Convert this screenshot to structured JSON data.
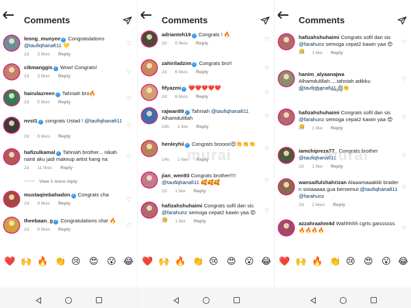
{
  "screen_title": "Comments",
  "reply_label": "Reply",
  "watermark": "murai",
  "panels": [
    {
      "comments": [
        {
          "user": "leong_munyee",
          "verified": true,
          "text": "Congratulations",
          "mention": "@taufiqhanafi11",
          "emoji": "💛",
          "time": "1d",
          "likes": "3 likes",
          "avatar": "#6b8f9a"
        },
        {
          "user": "cikmanggis",
          "verified": true,
          "text": "Wow! Congrats!",
          "time": "1d",
          "likes": "3 likes",
          "avatar": "#c27f6a"
        },
        {
          "user": "hairulazreen",
          "verified": true,
          "text": "Tahniah bro🔥",
          "time": "1d",
          "likes": "5 likes",
          "avatar": "#2f7d56"
        },
        {
          "user": "nvst1",
          "verified": true,
          "text": "congrats Ustad !",
          "mention": "@taufiqhanafi11",
          "time": "2d",
          "likes": "6 likes",
          "avatar": "#3a3a3a"
        },
        {
          "user": "hafizulkamal",
          "verified": true,
          "text": "Tahniah brother... nikah nanti aku jadi makeup artist hang na",
          "time": "2d",
          "likes": "11 likes",
          "avatar": "#b05a5a"
        },
        {
          "user": "mustaqimbahadon",
          "verified": true,
          "text": "Congrats cha",
          "time": "2d",
          "likes": "9 likes",
          "avatar": "#a34a3c"
        },
        {
          "user": "theebaan_g",
          "verified": true,
          "text": "Congratulations cha! 🔥",
          "time": "2d",
          "likes": "6 likes",
          "avatar": "#d2a23a"
        }
      ],
      "view_replies": "View 1 more reply",
      "emoji_bar": [
        "❤️",
        "🙌",
        "🔥",
        "👏",
        "😢",
        "😍",
        "😮",
        "😂"
      ]
    },
    {
      "comments": [
        {
          "user": "adrianteh19",
          "verified": true,
          "text": "Congrats ! 🔥",
          "time": "2d",
          "likes": "5 likes",
          "avatar": "#4a4a3a"
        },
        {
          "user": "zahiriladzim",
          "verified": true,
          "text": "Congrats bro!!",
          "time": "2d",
          "likes": "6 likes",
          "avatar": "#c98a5a"
        },
        {
          "user": "fifyazmi",
          "verified": true,
          "text": "❤️❤️❤️❤️❤️",
          "time": "2d",
          "likes": "6 likes",
          "avatar": "#d0a070"
        },
        {
          "user": "rajwan89",
          "verified": true,
          "text": "Tahniah",
          "mention": "@taufiqhanafi11",
          "text2": "Alhamdulillah",
          "time": "14h",
          "likes": "1 like",
          "avatar": "#3a6fb0"
        },
        {
          "user": "henleyhii",
          "verified": true,
          "text": "Congrats broooo😍👏👏👏",
          "time": "14h",
          "likes": "1 like",
          "avatar": "#b7845a"
        },
        {
          "user": "jian_wen93",
          "verified": false,
          "text": "Congrats brother!!!!",
          "mention": "@taufiqhanafi11",
          "emoji": "🥰🥰🥰",
          "time": "2d",
          "likes": "1 like",
          "avatar": "#c07a8a"
        },
        {
          "user": "hafizahshuhaimi",
          "verified": false,
          "text": "Congrats sofil dan sis",
          "mention": "@farahunz",
          "text2": "semoga cepat2 kawin yaa 😍👏",
          "time": "2d",
          "likes": "1 like",
          "avatar": "#b06a6a"
        }
      ],
      "emoji_bar": [
        "❤️",
        "🙌",
        "🔥",
        "👏",
        "😢",
        "😍",
        "😮",
        "😂"
      ]
    },
    {
      "comments": [
        {
          "user": "hafizahshuhaimi",
          "verified": false,
          "text": "Congrats sofil dan sis",
          "mention": "@farahunz",
          "text2": "semoga cepat2 kawin yaa 😍👏",
          "time": "2d",
          "likes": "1 like",
          "avatar": "#b06a6a"
        },
        {
          "user": "hanim_alyaanajwa",
          "verified": false,
          "text": "Alhamdulillah.....tahniah adikku",
          "mention": "@taufiqhanafi11",
          "emoji": "😍👏",
          "time": "2d",
          "likes": "1 like",
          "avatar": "#8a8f6a"
        },
        {
          "user": "hafizahshuhaimi",
          "verified": false,
          "text": "Congrats sofil dan sis",
          "mention": "@farahunz",
          "text2": "semoga cepat2 kawin yaa 😍👏",
          "time": "2d",
          "likes": "1 like",
          "avatar": "#b06a6a"
        },
        {
          "user": "iamchipreza77_",
          "verified": false,
          "text": "Congrats brother",
          "mention": "@taufiqhanafi11",
          "time": "2d",
          "likes": "1 like",
          "avatar": "#4a5a3a"
        },
        {
          "user": "wansaifulshahrizan",
          "verified": false,
          "text": "Alaaamaaakkk brader n sistaaaaa gua bersemut",
          "mention": "@taufiqhanafi11 @farahunz",
          "time": "2d",
          "likes": "2 likes",
          "avatar": "#8a6a4a"
        },
        {
          "user": "azzahraahm4d",
          "verified": false,
          "text": "Wahhhhh cgrts gaissssss🔥🔥🔥🔥",
          "time": "",
          "likes": "",
          "avatar": "#a04a6a"
        }
      ],
      "emoji_bar": [
        "❤️",
        "🙌",
        "🔥",
        "👏",
        "😢",
        "😍",
        "😮",
        "😂"
      ]
    }
  ]
}
